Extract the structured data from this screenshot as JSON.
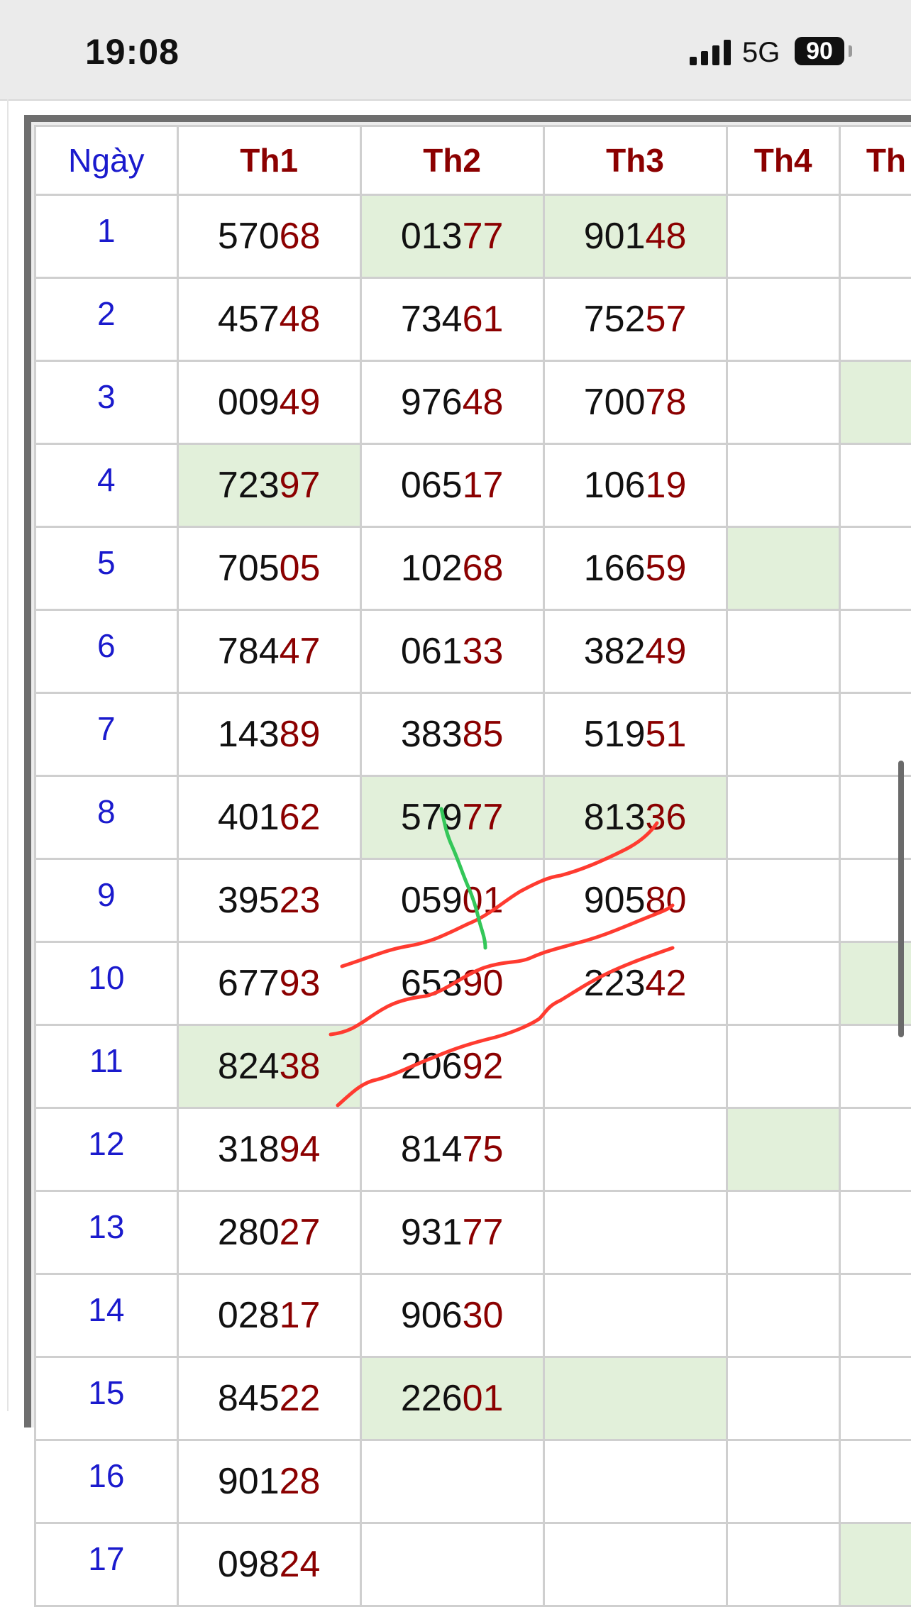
{
  "status_bar": {
    "time": "19:08",
    "network": "5G",
    "battery": "90"
  },
  "table": {
    "headers": [
      "Ngày",
      "Th1",
      "Th2",
      "Th3",
      "Th4",
      "Th"
    ],
    "rows": [
      {
        "day": "1",
        "cells": [
          {
            "head": "570",
            "tail": "68",
            "hl": false
          },
          {
            "head": "013",
            "tail": "77",
            "hl": true
          },
          {
            "head": "901",
            "tail": "48",
            "hl": true
          },
          {
            "head": "",
            "tail": "",
            "hl": false
          },
          {
            "head": "",
            "tail": "",
            "hl": false
          }
        ]
      },
      {
        "day": "2",
        "cells": [
          {
            "head": "457",
            "tail": "48",
            "hl": false
          },
          {
            "head": "734",
            "tail": "61",
            "hl": false
          },
          {
            "head": "752",
            "tail": "57",
            "hl": false
          },
          {
            "head": "",
            "tail": "",
            "hl": false
          },
          {
            "head": "",
            "tail": "",
            "hl": false
          }
        ]
      },
      {
        "day": "3",
        "cells": [
          {
            "head": "009",
            "tail": "49",
            "hl": false
          },
          {
            "head": "976",
            "tail": "48",
            "hl": false
          },
          {
            "head": "700",
            "tail": "78",
            "hl": false
          },
          {
            "head": "",
            "tail": "",
            "hl": false
          },
          {
            "head": "",
            "tail": "",
            "hl": true
          }
        ]
      },
      {
        "day": "4",
        "cells": [
          {
            "head": "723",
            "tail": "97",
            "hl": true
          },
          {
            "head": "065",
            "tail": "17",
            "hl": false
          },
          {
            "head": "106",
            "tail": "19",
            "hl": false
          },
          {
            "head": "",
            "tail": "",
            "hl": false
          },
          {
            "head": "",
            "tail": "",
            "hl": false
          }
        ]
      },
      {
        "day": "5",
        "cells": [
          {
            "head": "705",
            "tail": "05",
            "hl": false
          },
          {
            "head": "102",
            "tail": "68",
            "hl": false
          },
          {
            "head": "166",
            "tail": "59",
            "hl": false
          },
          {
            "head": "",
            "tail": "",
            "hl": true
          },
          {
            "head": "",
            "tail": "",
            "hl": false
          }
        ]
      },
      {
        "day": "6",
        "cells": [
          {
            "head": "784",
            "tail": "47",
            "hl": false
          },
          {
            "head": "061",
            "tail": "33",
            "hl": false
          },
          {
            "head": "382",
            "tail": "49",
            "hl": false
          },
          {
            "head": "",
            "tail": "",
            "hl": false
          },
          {
            "head": "",
            "tail": "",
            "hl": false
          }
        ]
      },
      {
        "day": "7",
        "cells": [
          {
            "head": "143",
            "tail": "89",
            "hl": false
          },
          {
            "head": "383",
            "tail": "85",
            "hl": false
          },
          {
            "head": "519",
            "tail": "51",
            "hl": false
          },
          {
            "head": "",
            "tail": "",
            "hl": false
          },
          {
            "head": "",
            "tail": "",
            "hl": false
          }
        ]
      },
      {
        "day": "8",
        "cells": [
          {
            "head": "401",
            "tail": "62",
            "hl": false
          },
          {
            "head": "579",
            "tail": "77",
            "hl": true
          },
          {
            "head": "813",
            "tail": "36",
            "hl": true
          },
          {
            "head": "",
            "tail": "",
            "hl": false
          },
          {
            "head": "",
            "tail": "",
            "hl": false
          }
        ]
      },
      {
        "day": "9",
        "cells": [
          {
            "head": "395",
            "tail": "23",
            "hl": false
          },
          {
            "head": "059",
            "tail": "01",
            "hl": false
          },
          {
            "head": "905",
            "tail": "80",
            "hl": false
          },
          {
            "head": "",
            "tail": "",
            "hl": false
          },
          {
            "head": "",
            "tail": "",
            "hl": false
          }
        ]
      },
      {
        "day": "10",
        "cells": [
          {
            "head": "677",
            "tail": "93",
            "hl": false
          },
          {
            "head": "653",
            "tail": "90",
            "hl": false
          },
          {
            "head": "223",
            "tail": "42",
            "hl": false
          },
          {
            "head": "",
            "tail": "",
            "hl": false
          },
          {
            "head": "",
            "tail": "",
            "hl": true
          }
        ]
      },
      {
        "day": "11",
        "cells": [
          {
            "head": "824",
            "tail": "38",
            "hl": true
          },
          {
            "head": "206",
            "tail": "92",
            "hl": false
          },
          {
            "head": "",
            "tail": "",
            "hl": false
          },
          {
            "head": "",
            "tail": "",
            "hl": false
          },
          {
            "head": "",
            "tail": "",
            "hl": false
          }
        ]
      },
      {
        "day": "12",
        "cells": [
          {
            "head": "318",
            "tail": "94",
            "hl": false
          },
          {
            "head": "814",
            "tail": "75",
            "hl": false
          },
          {
            "head": "",
            "tail": "",
            "hl": false
          },
          {
            "head": "",
            "tail": "",
            "hl": true
          },
          {
            "head": "",
            "tail": "",
            "hl": false
          }
        ]
      },
      {
        "day": "13",
        "cells": [
          {
            "head": "280",
            "tail": "27",
            "hl": false
          },
          {
            "head": "931",
            "tail": "77",
            "hl": false
          },
          {
            "head": "",
            "tail": "",
            "hl": false
          },
          {
            "head": "",
            "tail": "",
            "hl": false
          },
          {
            "head": "",
            "tail": "",
            "hl": false
          }
        ]
      },
      {
        "day": "14",
        "cells": [
          {
            "head": "028",
            "tail": "17",
            "hl": false
          },
          {
            "head": "906",
            "tail": "30",
            "hl": false
          },
          {
            "head": "",
            "tail": "",
            "hl": false
          },
          {
            "head": "",
            "tail": "",
            "hl": false
          },
          {
            "head": "",
            "tail": "",
            "hl": false
          }
        ]
      },
      {
        "day": "15",
        "cells": [
          {
            "head": "845",
            "tail": "22",
            "hl": false
          },
          {
            "head": "226",
            "tail": "01",
            "hl": true
          },
          {
            "head": "",
            "tail": "",
            "hl": true
          },
          {
            "head": "",
            "tail": "",
            "hl": false
          },
          {
            "head": "",
            "tail": "",
            "hl": false
          }
        ]
      },
      {
        "day": "16",
        "cells": [
          {
            "head": "901",
            "tail": "28",
            "hl": false
          },
          {
            "head": "",
            "tail": "",
            "hl": false
          },
          {
            "head": "",
            "tail": "",
            "hl": false
          },
          {
            "head": "",
            "tail": "",
            "hl": false
          },
          {
            "head": "",
            "tail": "",
            "hl": false
          }
        ]
      },
      {
        "day": "17",
        "cells": [
          {
            "head": "098",
            "tail": "24",
            "hl": false
          },
          {
            "head": "",
            "tail": "",
            "hl": false
          },
          {
            "head": "",
            "tail": "",
            "hl": false
          },
          {
            "head": "",
            "tail": "",
            "hl": false
          },
          {
            "head": "",
            "tail": "",
            "hl": true
          }
        ]
      }
    ]
  },
  "colors": {
    "day_blue": "#1a1acd",
    "tail_red": "#8b0000",
    "highlight_green": "#e2f0da",
    "annotation_red": "#ff3b30",
    "annotation_green": "#34c759"
  },
  "annotations": [
    "red-hand-drawn-line",
    "red-hand-drawn-line",
    "red-hand-drawn-line",
    "green-hand-drawn-line"
  ]
}
